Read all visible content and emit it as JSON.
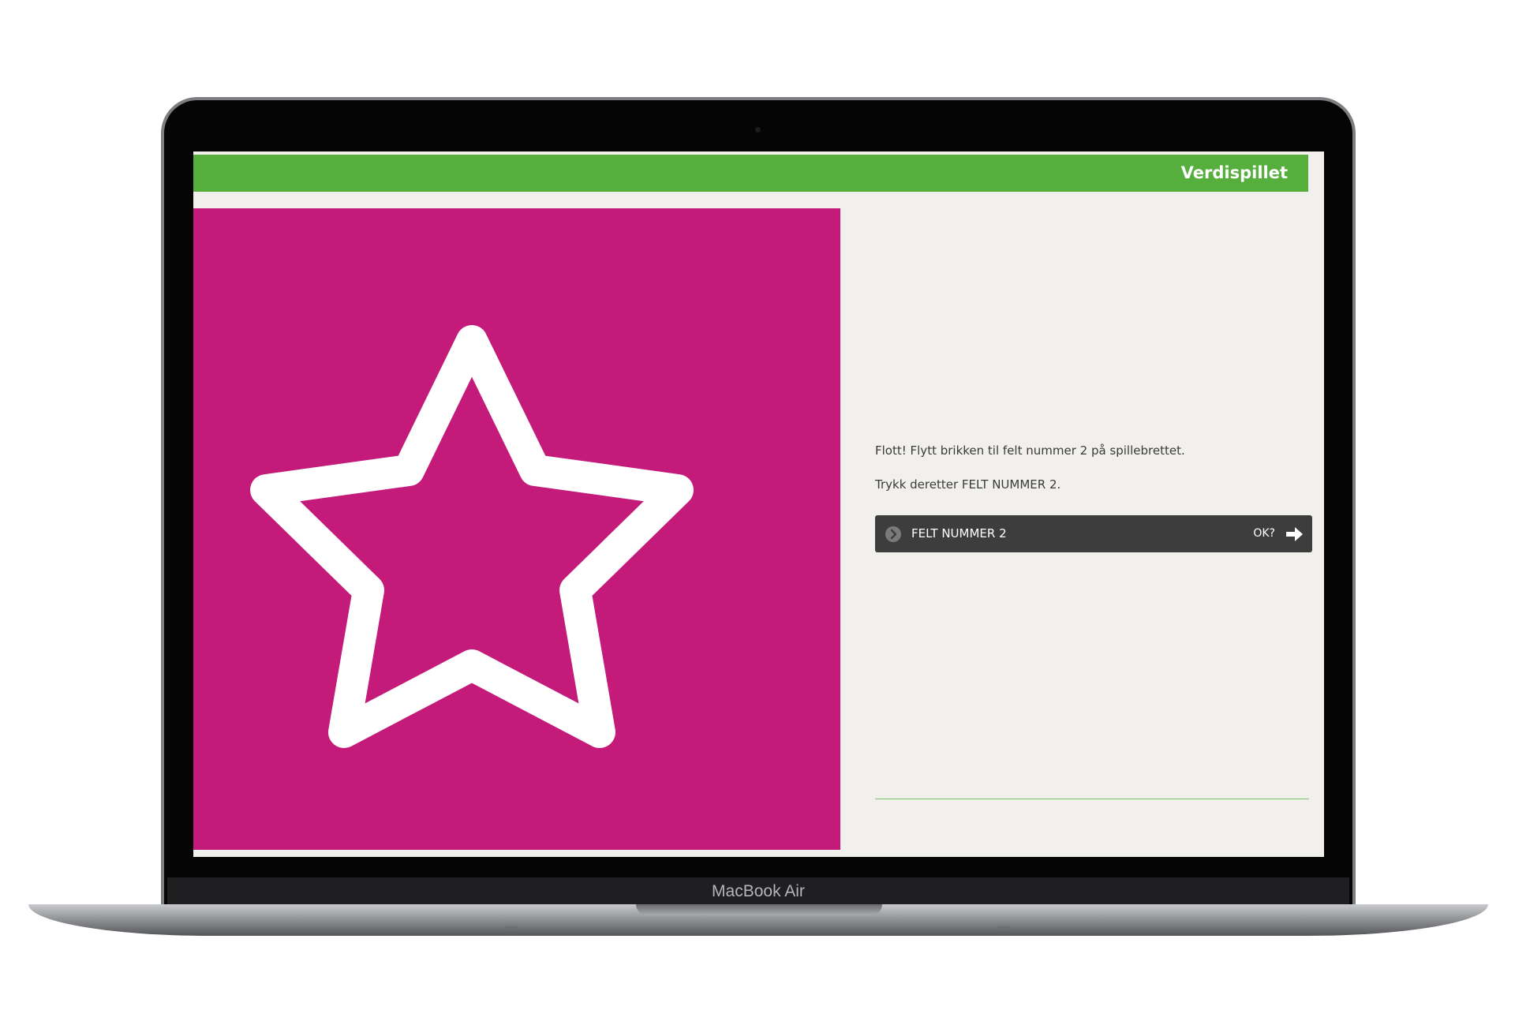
{
  "app": {
    "title": "Verdispillet"
  },
  "device": {
    "label": "MacBook Air"
  },
  "main": {
    "message": "Flott! Flytt brikken til felt nummer 2 på spillebrettet.",
    "instruction": "Trykk deretter FELT NUMMER 2.",
    "action": {
      "label": "FELT NUMMER 2",
      "confirm_label": "OK?"
    }
  },
  "colors": {
    "header": "#56ae3c",
    "image_background": "#c41a7a",
    "button_background": "#3d3d3d",
    "content_background": "#f1f0ec"
  },
  "icons": {
    "image": "star-outline-icon",
    "action_leading": "chevron-right-circle-icon",
    "action_trailing": "arrow-right-icon"
  }
}
